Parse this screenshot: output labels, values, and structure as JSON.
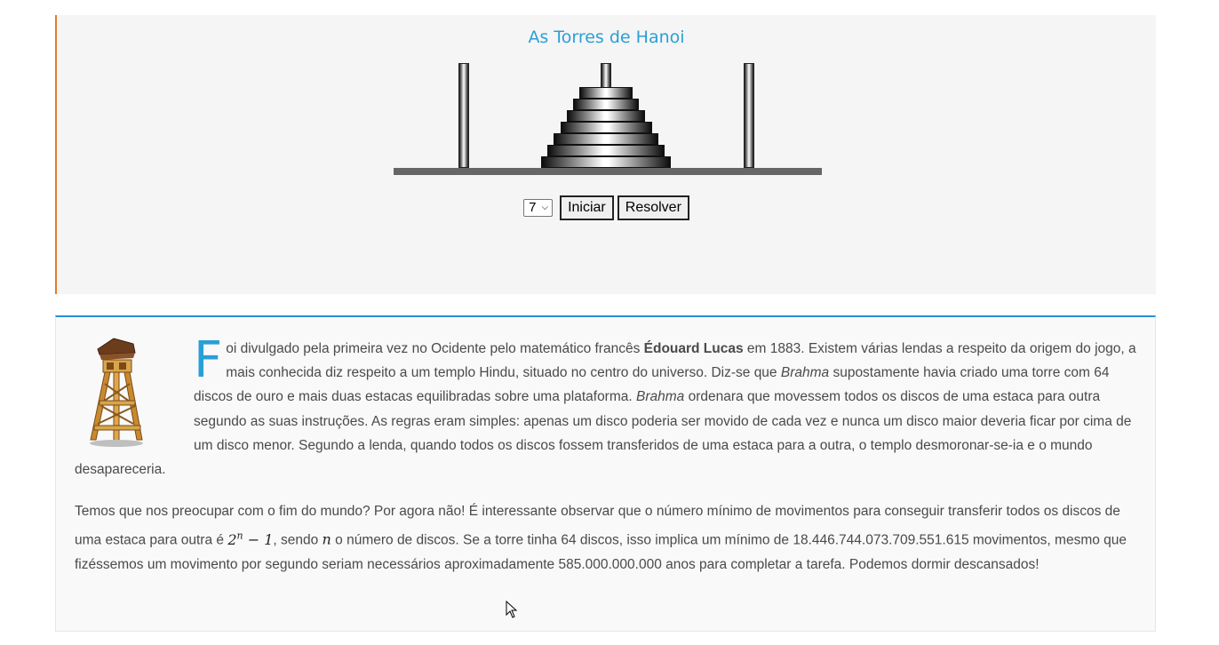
{
  "game": {
    "title": "As Torres de Hanoi",
    "disk_count": 7,
    "select_value": "7",
    "start_button": "Iniciar",
    "solve_button": "Resolver"
  },
  "article": {
    "p1": {
      "dropcap": "F",
      "t1": "oi divulgado pela primeira vez no Ocidente pelo matemático francês ",
      "b1": "Édouard Lucas",
      "t2": " em 1883. Existem várias lendas a respeito da origem do jogo, a mais conhecida diz respeito a um templo Hindu, situado no centro do universo. Diz-se que ",
      "i1": "Brahma",
      "t3": " supostamente havia criado uma torre com 64 discos de ouro e mais duas estacas equilibradas sobre uma plataforma. ",
      "i2": "Brahma",
      "t4": " ordenara que movessem todos os discos de uma estaca para outra segundo as suas instruções. As regras eram simples: apenas um disco poderia ser movido de cada vez e nunca um disco maior deveria ficar por cima de um disco menor. Segundo a lenda, quando todos os discos fossem transferidos de uma estaca para a outra, o templo desmoronar-se-ia e o mundo desapareceria."
    },
    "p2": {
      "t1": "Temos que nos preocupar com o fim do mundo? Por agora não! É interessante observar que o número mínimo de movimentos para conseguir transferir todos os discos de uma estaca para outra é ",
      "math_base": "2",
      "math_exp": "n",
      "math_rest": " − 1",
      "t2": ", sendo ",
      "math_var": "n",
      "t3": " o número de discos. Se a torre tinha 64 discos, isso implica um mínimo de 18.446.744.073.709.551.615 movimentos, mesmo que fizéssemos um movimento por segundo seriam necessários aproximadamente 585.000.000.000 anos para completar a tarefa. Podemos dormir descansados!"
    }
  },
  "colors": {
    "title": "#2a9fd6",
    "game_border": "#e07b2a",
    "article_border": "#2a8fd6"
  },
  "icons": {
    "tower": "wooden-watchtower-icon",
    "cursor": "mouse-pointer-icon"
  }
}
